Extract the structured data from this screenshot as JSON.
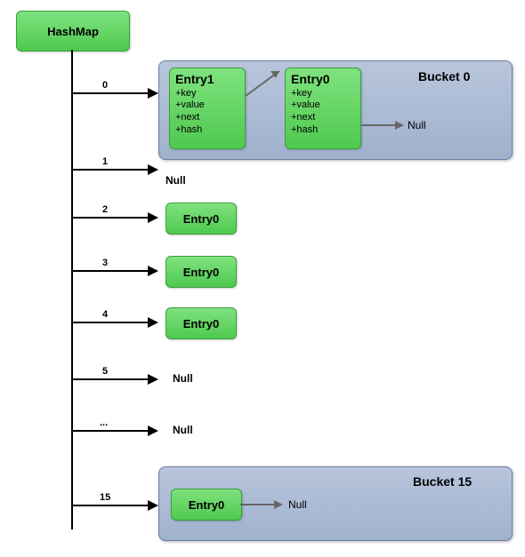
{
  "title": "HashMap",
  "indices": [
    "0",
    "1",
    "2",
    "3",
    "4",
    "5",
    "...",
    "15"
  ],
  "bucket0": {
    "label": "Bucket 0",
    "entry1": {
      "title": "Entry1",
      "fields": [
        "+key",
        "+value",
        "+next",
        "+hash"
      ]
    },
    "entry0": {
      "title": "Entry0",
      "fields": [
        "+key",
        "+value",
        "+next",
        "+hash"
      ]
    },
    "null": "Null"
  },
  "rows": {
    "r1": "Null",
    "r2": "Entry0",
    "r3": "Entry0",
    "r4": "Entry0",
    "r5": "Null",
    "rdots": "Null"
  },
  "bucket15": {
    "label": "Bucket 15",
    "entry0": "Entry0",
    "null": "Null"
  }
}
